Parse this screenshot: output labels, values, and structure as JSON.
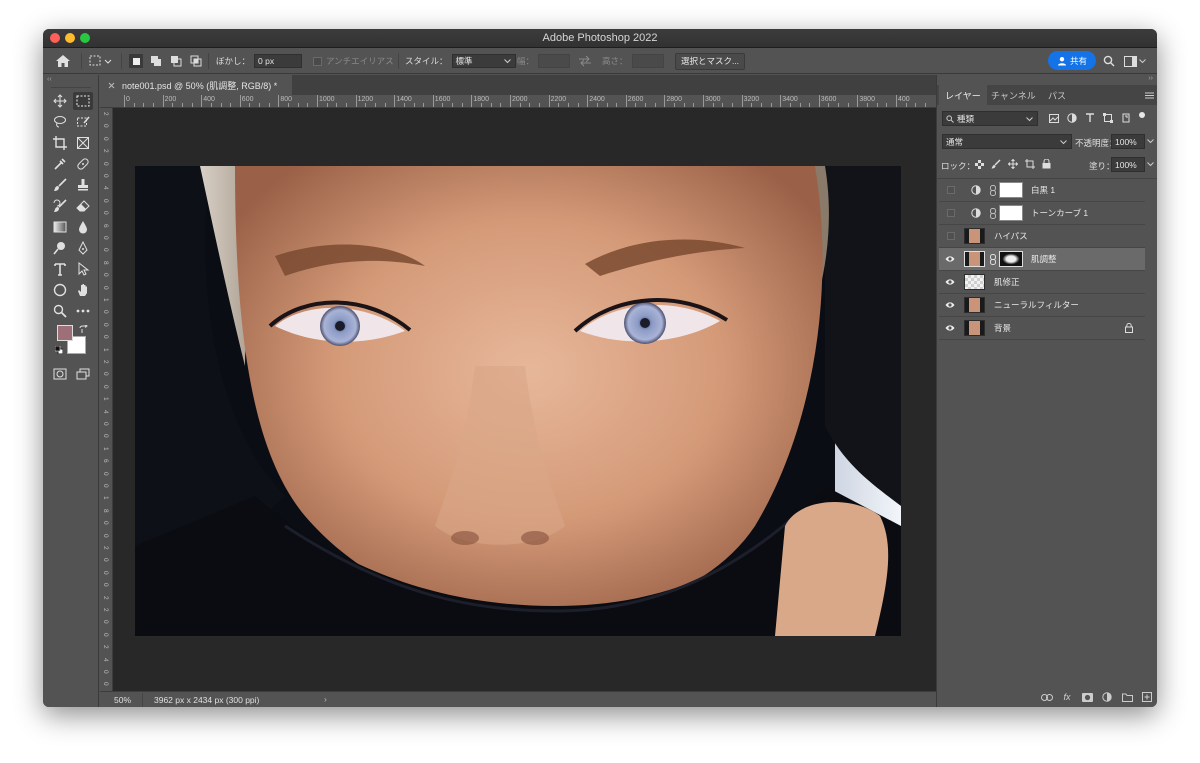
{
  "app": {
    "title": "Adobe Photoshop 2022"
  },
  "options_bar": {
    "feather_label": "ぼかし：",
    "feather_value": "0 px",
    "antialias_label": "アンチエイリアス",
    "style_label": "スタイル：",
    "style_value": "標準",
    "width_label": "幅：",
    "height_label": "高さ：",
    "select_mask_label": "選択とマスク...",
    "share_label": "共有"
  },
  "document": {
    "tab_title": "note001.psd @ 50% (肌調整, RGB/8) *",
    "ruler_top": [
      "0",
      "200",
      "400",
      "600",
      "800",
      "1000",
      "1200",
      "1400",
      "1600",
      "1800",
      "2000",
      "2200",
      "2400",
      "2600",
      "2800",
      "3000",
      "3200",
      "3400",
      "3600",
      "3800",
      "400"
    ],
    "ruler_left": [
      "2",
      "0",
      "0",
      "2",
      "0",
      "0",
      "4",
      "0",
      "0",
      "6",
      "0",
      "0",
      "8",
      "0",
      "0",
      "1",
      "0",
      "0",
      "0",
      "1",
      "2",
      "0",
      "0",
      "1",
      "4",
      "0",
      "0",
      "1",
      "6",
      "0",
      "0",
      "1",
      "8",
      "0",
      "0",
      "2",
      "0",
      "0",
      "0",
      "2",
      "2",
      "0",
      "0",
      "2",
      "4",
      "0",
      "0"
    ],
    "zoom": "50%",
    "info": "3962 px x 2434 px (300 ppi)"
  },
  "layers_panel": {
    "tabs": [
      "レイヤー",
      "チャンネル",
      "パス"
    ],
    "active_tab": "レイヤー",
    "filter_kind": "種類",
    "blend_mode": "通常",
    "opacity_label": "不透明度：",
    "opacity_value": "100%",
    "lock_label": "ロック：",
    "fill_label": "塗り：",
    "fill_value": "100%",
    "layers": [
      {
        "name": "白黒 1",
        "visible": false,
        "type": "adjustment"
      },
      {
        "name": "トーンカーブ 1",
        "visible": false,
        "type": "adjustment"
      },
      {
        "name": "ハイパス",
        "visible": false,
        "type": "pixel"
      },
      {
        "name": "肌調整",
        "visible": true,
        "type": "pixel-mask",
        "selected": true
      },
      {
        "name": "肌修正",
        "visible": true,
        "type": "pixel"
      },
      {
        "name": "ニューラルフィルター",
        "visible": true,
        "type": "pixel"
      },
      {
        "name": "背景",
        "visible": true,
        "type": "background",
        "locked": true
      }
    ]
  },
  "colors": {
    "foreground": "#9d6f79",
    "background": "#ffffff",
    "accent": "#1473e6"
  }
}
